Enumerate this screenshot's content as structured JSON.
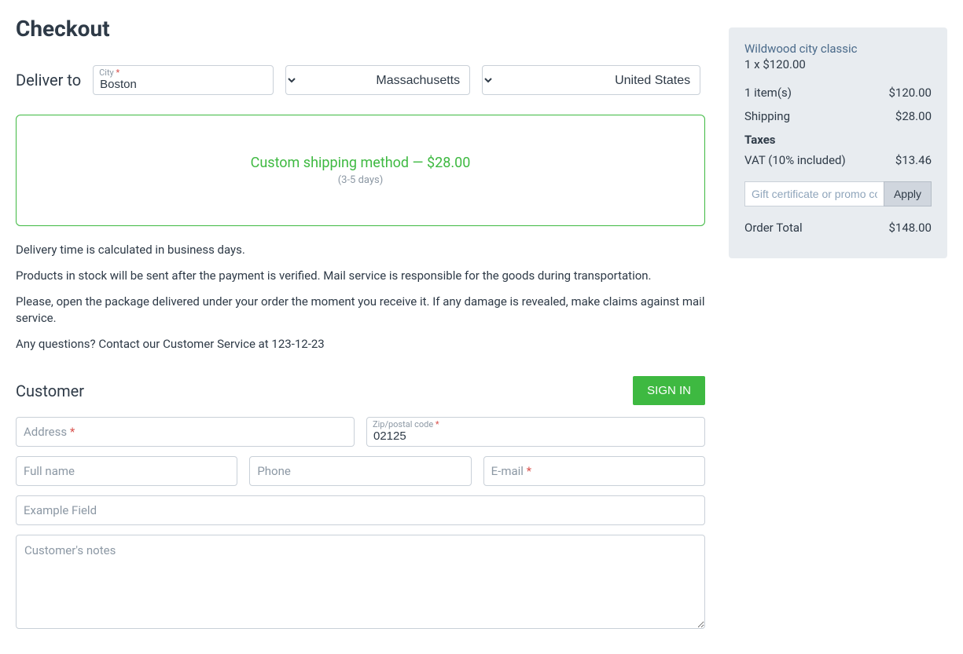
{
  "page_title": "Checkout",
  "deliver": {
    "label": "Deliver to",
    "city_label": "City",
    "city_value": "Boston",
    "state_value": "Massachusetts",
    "country_value": "United States"
  },
  "shipping": {
    "title": "Custom shipping method — $28.00",
    "subtitle": "(3-5 days)"
  },
  "info": {
    "p1": "Delivery time is calculated in business days.",
    "p2": "Products in stock will be sent after the payment is verified. Mail service is responsible for the goods during transportation.",
    "p3": "Please, open the package delivered under your order the moment you receive it. If any damage is revealed, make claims against mail service.",
    "p4": "Any questions? Contact our Customer Service at 123-12-23"
  },
  "customer": {
    "heading": "Customer",
    "signin": "SIGN IN",
    "address_placeholder": "Address",
    "zip_label": "Zip/postal code",
    "zip_value": "02125",
    "fullname_placeholder": "Full name",
    "phone_placeholder": "Phone",
    "email_placeholder": "E-mail",
    "example_placeholder": "Example Field",
    "notes_placeholder": "Customer's notes"
  },
  "summary": {
    "product_name": "Wildwood city classic",
    "product_qty": "1 x $120.00",
    "items_label": "1 item(s)",
    "items_value": "$120.00",
    "shipping_label": "Shipping",
    "shipping_value": "$28.00",
    "taxes_label": "Taxes",
    "vat_label": "VAT (10% included)",
    "vat_value": "$13.46",
    "promo_placeholder": "Gift certificate or promo code",
    "apply": "Apply",
    "total_label": "Order Total",
    "total_value": "$148.00"
  }
}
